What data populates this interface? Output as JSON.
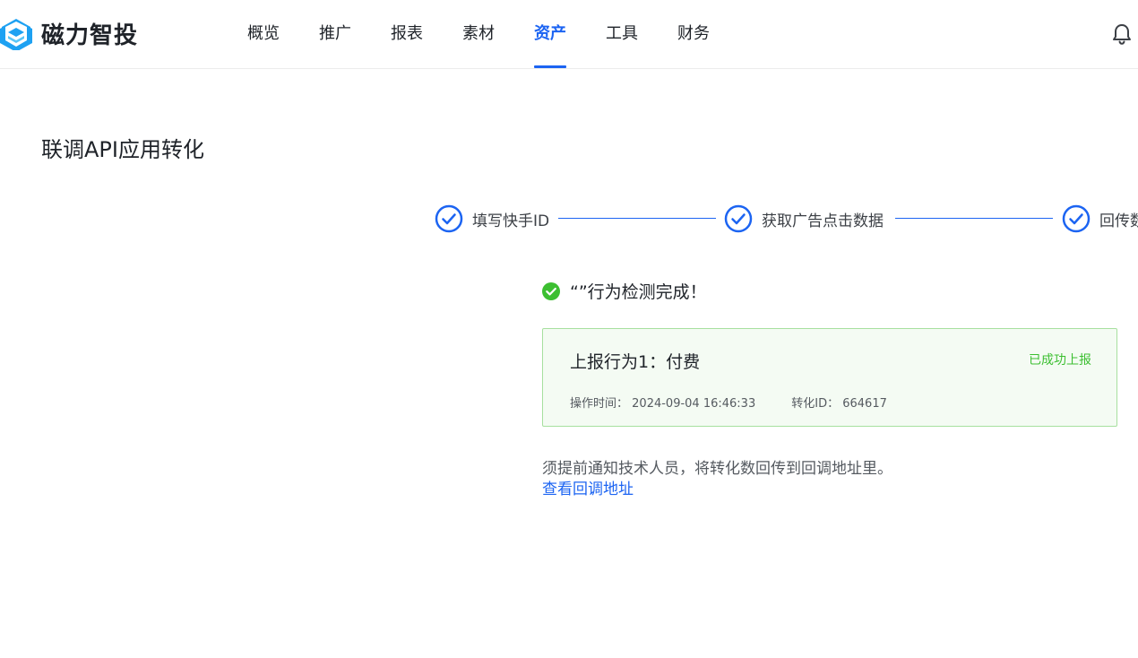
{
  "brand": {
    "name": "磁力智投",
    "accent": "#1c64f2",
    "logo_color": "#1ea1f2"
  },
  "nav": {
    "items": [
      {
        "label": "概览"
      },
      {
        "label": "推广"
      },
      {
        "label": "报表"
      },
      {
        "label": "素材"
      },
      {
        "label": "资产",
        "active": true
      },
      {
        "label": "工具"
      },
      {
        "label": "财务"
      }
    ],
    "bell_icon": "bell-icon"
  },
  "page": {
    "title": "联调API应用转化"
  },
  "steps": [
    {
      "label": "填写快手ID",
      "status": "done",
      "icon": "check-circle-icon"
    },
    {
      "label": "获取广告点击数据",
      "status": "done",
      "icon": "check-circle-icon"
    },
    {
      "label": "回传数据",
      "status": "done",
      "icon": "check-circle-icon"
    }
  ],
  "result": {
    "icon": "success-check-icon",
    "color": "#3cbf31",
    "message": "“”行为检测完成！"
  },
  "report": {
    "title": "上报行为1：付费",
    "status": "已成功上报",
    "time_label": "操作时间：",
    "time_value": "2024-09-04 16:46:33",
    "id_label": "转化ID：",
    "id_value": "664617"
  },
  "notice": {
    "text": "须提前通知技术人员，将转化数回传到回调地址里。",
    "link": "查看回调地址"
  }
}
